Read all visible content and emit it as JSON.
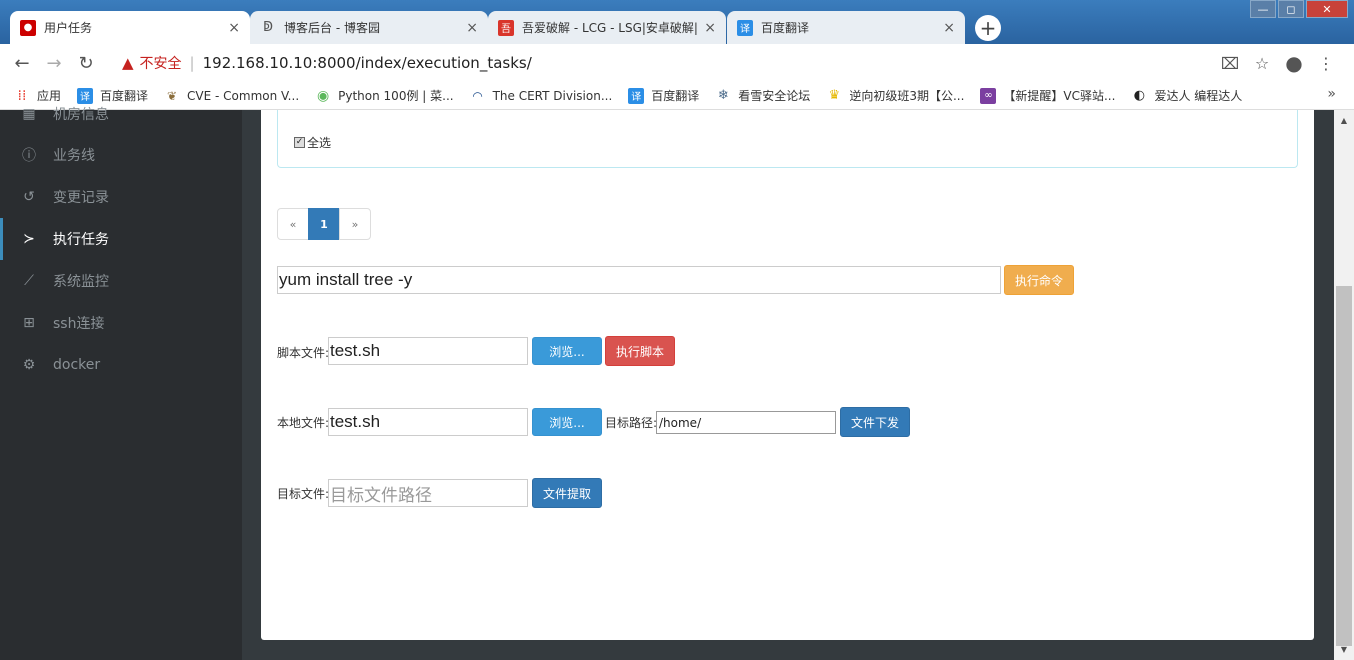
{
  "browser": {
    "tabs": [
      {
        "title": "用户任务",
        "icon": "redhat-icon",
        "color": "#cc0000",
        "active": true
      },
      {
        "title": "博客后台 - 博客园",
        "icon": "cnblogs-icon",
        "color": "#555555",
        "active": false
      },
      {
        "title": "吾爱破解 - LCG - LSG|安卓破解|",
        "icon": "52pojie-icon",
        "color": "#d9352b",
        "active": false
      },
      {
        "title": "百度翻译",
        "icon": "baidu-translate-icon",
        "color": "#2b8ee6",
        "active": false
      }
    ],
    "close_glyph": "×",
    "new_tab_glyph": "+",
    "window_controls": {
      "minimize": "—",
      "maximize": "◻",
      "close": "✕"
    },
    "insecure_label": "不安全",
    "url": "192.168.10.10:8000/index/execution_tasks/",
    "bookmarks": [
      {
        "label": "应用",
        "icon": "apps-grid-icon",
        "color": "#e94235"
      },
      {
        "label": "百度翻译",
        "icon": "baidu-translate-icon",
        "color": "#2b8ee6"
      },
      {
        "label": "CVE - Common V...",
        "icon": "cve-icon",
        "color": "#8a6d3b"
      },
      {
        "label": "Python 100例 | 菜...",
        "icon": "runoob-icon",
        "color": "#5cb85c"
      },
      {
        "label": "The CERT Division...",
        "icon": "cert-icon",
        "color": "#1f4e8c"
      },
      {
        "label": "百度翻译",
        "icon": "baidu-translate-icon",
        "color": "#2b8ee6"
      },
      {
        "label": "看雪安全论坛",
        "icon": "snowflake-icon",
        "color": "#4a6a8a"
      },
      {
        "label": "逆向初级班3期【公...",
        "icon": "trophy-icon",
        "color": "#e6b800"
      },
      {
        "label": "【新提醒】VC驿站...",
        "icon": "vs-icon",
        "color": "#7b3fa0"
      },
      {
        "label": "爱达人 编程达人",
        "icon": "aidaren-icon",
        "color": "#222222"
      }
    ],
    "more_glyph": "»"
  },
  "sidebar": {
    "items": [
      {
        "label": "机房信息",
        "icon": "table-icon",
        "glyph": "▦",
        "active": false
      },
      {
        "label": "业务线",
        "icon": "info-icon",
        "glyph": "ⓘ",
        "active": false
      },
      {
        "label": "变更记录",
        "icon": "history-icon",
        "glyph": "↺",
        "active": false
      },
      {
        "label": "执行任务",
        "icon": "terminal-icon",
        "glyph": "≻",
        "active": true
      },
      {
        "label": "系统监控",
        "icon": "line-chart-icon",
        "glyph": "⟋",
        "active": false
      },
      {
        "label": "ssh连接",
        "icon": "sitemap-icon",
        "glyph": "⊞",
        "active": false
      },
      {
        "label": "docker",
        "icon": "cogs-icon",
        "glyph": "⚙",
        "active": false
      }
    ]
  },
  "main": {
    "select_all_label": "全选",
    "pagination": {
      "prev": "«",
      "current": "1",
      "next": "»"
    },
    "command": {
      "value": "yum install tree -y",
      "button": "执行命令"
    },
    "script": {
      "label": "脚本文件:",
      "value": "test.sh",
      "browse": "浏览...",
      "run": "执行脚本"
    },
    "upload": {
      "label": "本地文件:",
      "value": "test.sh",
      "browse": "浏览...",
      "target_label": "目标路径:",
      "target_value": "/home/",
      "button": "文件下发"
    },
    "fetch": {
      "label": "目标文件:",
      "placeholder": "目标文件路径",
      "button": "文件提取"
    }
  }
}
